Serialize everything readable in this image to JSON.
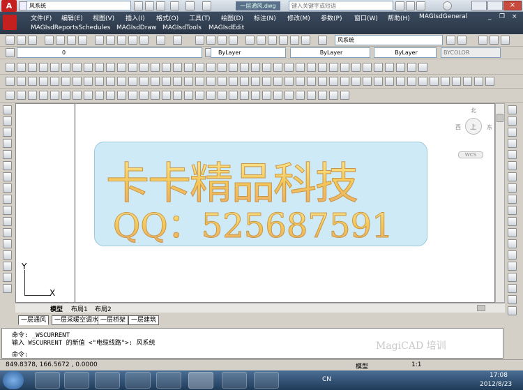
{
  "window": {
    "workspace": "风系统",
    "search_placeholder": "键入关键字或短语",
    "filename": "一层通风.dwg"
  },
  "menu": {
    "row1": [
      "文件(F)",
      "编辑(E)",
      "视图(V)",
      "插入(I)",
      "格式(O)",
      "工具(T)",
      "绘图(D)",
      "标注(N)",
      "修改(M)",
      "参数(P)",
      "窗口(W)",
      "帮助(H)",
      "MAGIsdGeneral"
    ],
    "row2": [
      "MAGIsdReportsSchedules",
      "MAGIsdDraw",
      "MAGIsdTools",
      "MAGIsdEdit"
    ]
  },
  "toolbar": {
    "workspace_select": "风系统",
    "layer_select": "0",
    "color_select": "ByLayer",
    "linetype_select": "ByLayer",
    "lineweight_select": "ByLayer",
    "plotstyle_select": "BYCOLOR"
  },
  "viewcube": {
    "north": "北",
    "west": "西",
    "east": "东",
    "top": "上",
    "wcs": "WCS"
  },
  "banner": {
    "line1": "卡卡精品科技",
    "line2": "QQ：525687591"
  },
  "ucs": {
    "x": "X",
    "y": "Y"
  },
  "layout_tabs": [
    "模型",
    "布局1",
    "布局2"
  ],
  "layer_tabs": [
    "一层通风",
    "一层采暖空调水",
    "一层桥架",
    "一层建筑"
  ],
  "command": {
    "line1": "命令: _WSCURRENT",
    "line2": "输入 WSCURRENT 的新值 <\"电缆线路\">: 风系统",
    "prompt": "命令:",
    "watermark": "MagiCAD  培训"
  },
  "status": {
    "coords": "849.8378,  166.5672 , 0.0000",
    "model": "模型",
    "scale": "1:1"
  },
  "taskbar": {
    "time": "17:08",
    "date": "2012/8/23",
    "lang": "CN"
  }
}
